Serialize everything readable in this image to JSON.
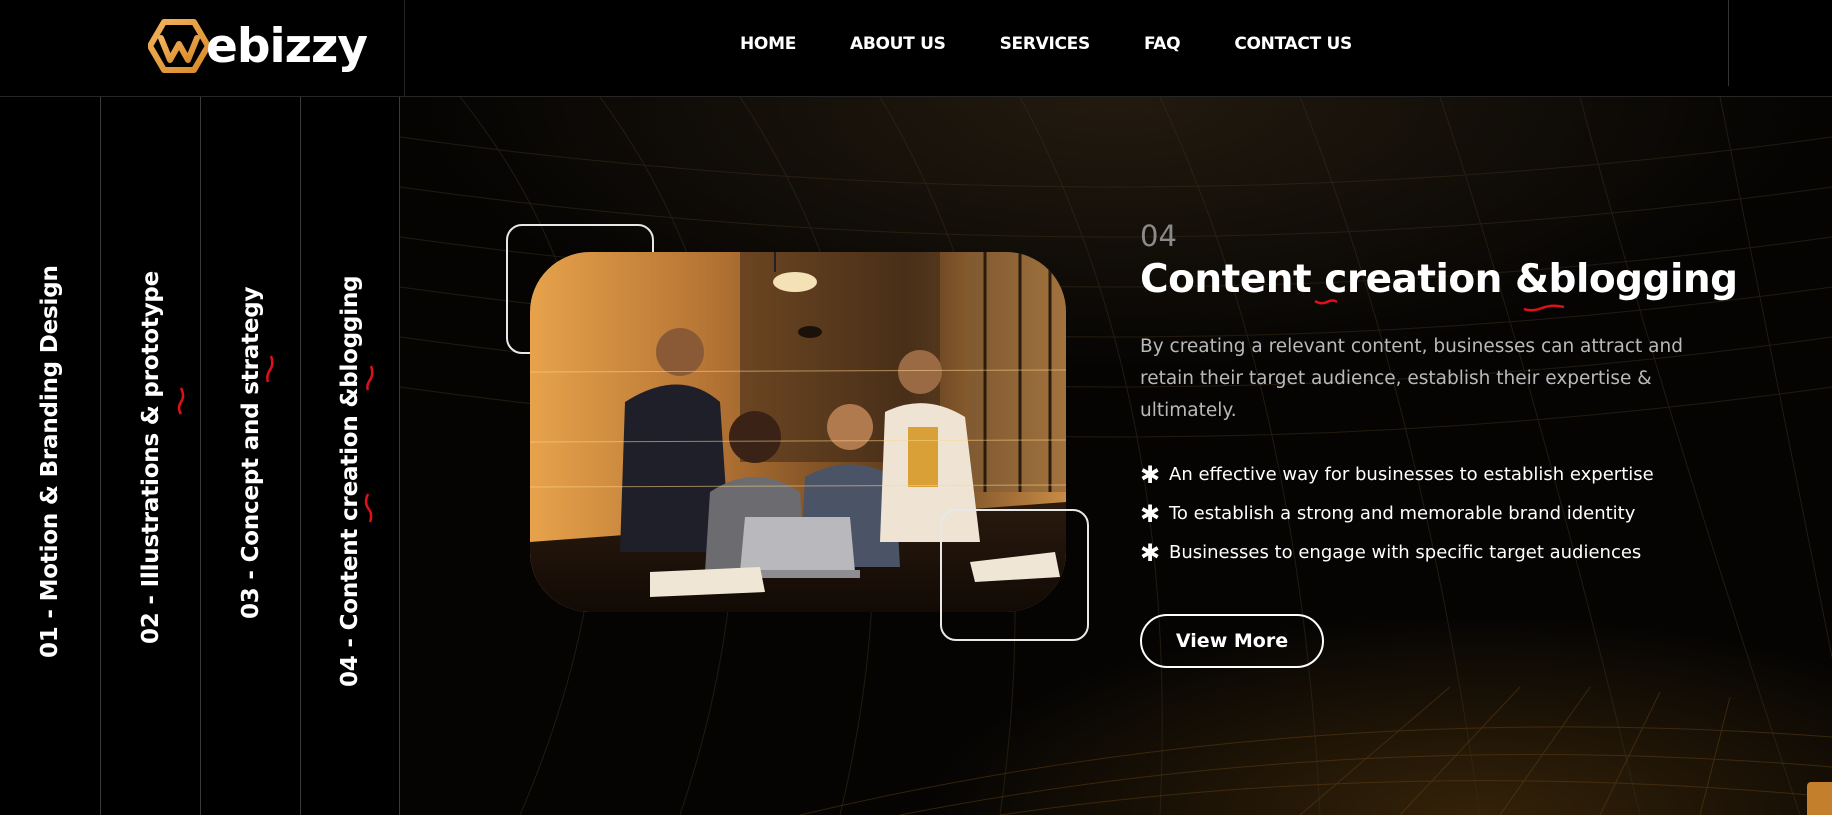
{
  "brand": {
    "logo_text": "ebizzy",
    "logo_icon": "hexagon-w-logo-icon",
    "accent_color": "#e39a3b"
  },
  "nav": {
    "items": [
      {
        "label": "HOME"
      },
      {
        "label": "ABOUT US"
      },
      {
        "label": "SERVICES"
      },
      {
        "label": "FAQ"
      },
      {
        "label": "CONTACT US"
      }
    ]
  },
  "tabs": {
    "items": [
      {
        "label": "01 - Motion & Branding Design"
      },
      {
        "label": "02 - Illustrations & prototype"
      },
      {
        "label": "03 - Concept and strategy"
      },
      {
        "label": "04 - Content creation &blogging"
      }
    ],
    "active_index": 3
  },
  "service": {
    "number": "04",
    "title": "Content creation &blogging",
    "description": "By creating a relevant content, businesses can attract and retain their target audience, establish their expertise & ultimately.",
    "bullet_icon": "asterisk-icon",
    "bullets": [
      "An effective way for businesses to establish expertise",
      "To establish a strong and memorable brand identity",
      "Businesses to engage with specific target audiences"
    ],
    "button_label": "View More",
    "image_alt_icon": "team-at-laptop-photo"
  },
  "colors": {
    "background": "#000000",
    "misspell_underline": "#e0101a"
  }
}
